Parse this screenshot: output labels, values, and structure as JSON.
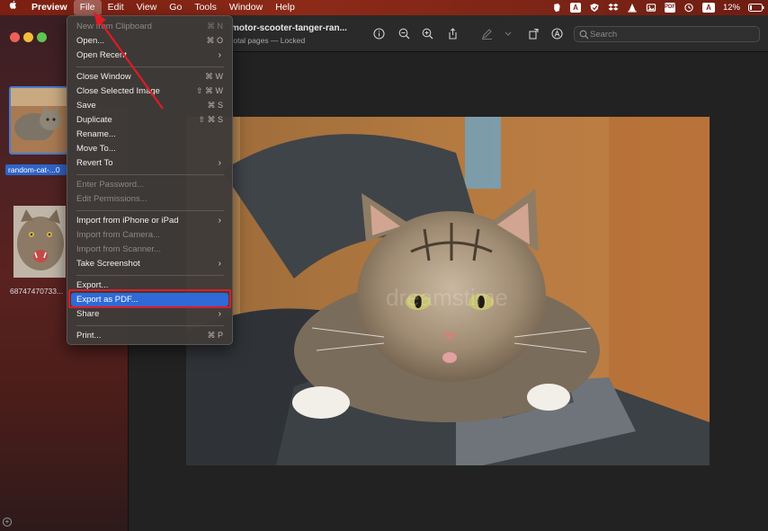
{
  "menubar": {
    "app": "Preview",
    "items": [
      "File",
      "Edit",
      "View",
      "Go",
      "Tools",
      "Window",
      "Help"
    ],
    "active_item": "File",
    "status": {
      "pdf_badge": "PDF",
      "a_badge": "A",
      "a_badge2": "A",
      "battery": "12%"
    }
  },
  "sidebar": {
    "thumbnails": [
      {
        "label": "random-cat-...0",
        "selected": true
      },
      {
        "label": "68747470733...",
        "selected": false
      }
    ]
  },
  "toolbar": {
    "title": "motor-scooter-tanger-ran...",
    "subtitle": "total pages — Locked",
    "search_placeholder": "Search"
  },
  "file_menu": {
    "items": [
      {
        "label": "New from Clipboard",
        "shortcut": "⌘ N",
        "disabled": true
      },
      {
        "label": "Open...",
        "shortcut": "⌘ O",
        "disabled": false
      },
      {
        "label": "Open Recent",
        "submenu": true,
        "disabled": false
      },
      {
        "label": "Close Window",
        "shortcut": "⌘ W",
        "disabled": false
      },
      {
        "label": "Close Selected Image",
        "shortcut": "⇧ ⌘ W",
        "disabled": false
      },
      {
        "label": "Save",
        "shortcut": "⌘ S",
        "disabled": false
      },
      {
        "label": "Duplicate",
        "shortcut": "⇧ ⌘ S",
        "disabled": false
      },
      {
        "label": "Rename...",
        "disabled": false
      },
      {
        "label": "Move To...",
        "disabled": false
      },
      {
        "label": "Revert To",
        "submenu": true,
        "disabled": false
      },
      {
        "label": "Enter Password...",
        "disabled": true
      },
      {
        "label": "Edit Permissions...",
        "disabled": true
      },
      {
        "label": "Import from iPhone or iPad",
        "submenu": true,
        "disabled": false
      },
      {
        "label": "Import from Camera...",
        "disabled": true
      },
      {
        "label": "Import from Scanner...",
        "disabled": true
      },
      {
        "label": "Take Screenshot",
        "submenu": true,
        "disabled": false
      },
      {
        "label": "Export...",
        "disabled": false
      },
      {
        "label": "Export as PDF...",
        "disabled": false,
        "highlighted": true
      },
      {
        "label": "Share",
        "submenu": true,
        "disabled": false
      },
      {
        "label": "Print...",
        "shortcut": "⌘ P",
        "disabled": false
      }
    ]
  },
  "image": {
    "subject": "tabby cat on scooter seat"
  },
  "colors": {
    "menubar": "#7a1f12",
    "highlight": "#2f6ad6",
    "annotation_red": "#e01b24",
    "selection_blue": "#2f64c7"
  }
}
